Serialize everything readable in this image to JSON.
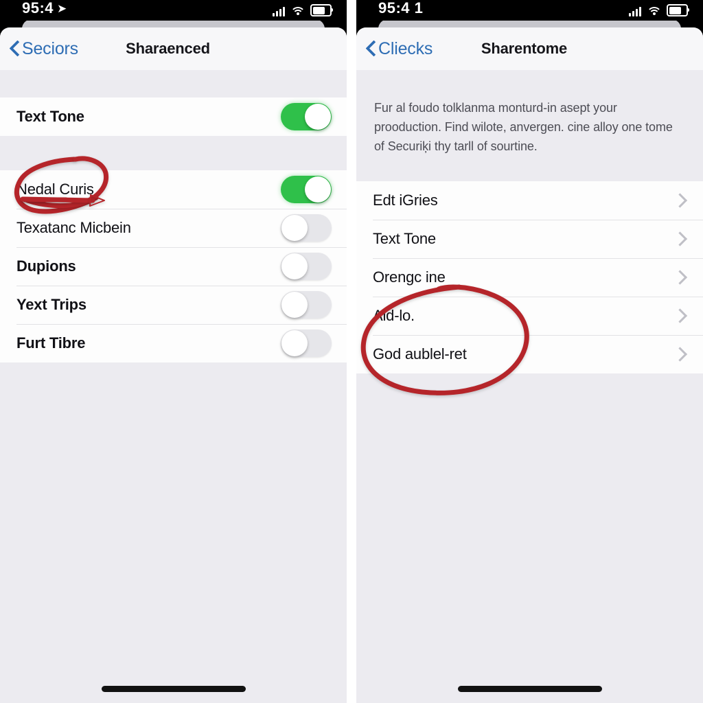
{
  "meta": {
    "accent_blue": "#2E6DB4",
    "toggle_green": "#2FC04A",
    "annotation_red": "#B5252A",
    "background_gray": "#ECEBF0",
    "row_white": "#FDFDFD"
  },
  "left": {
    "status": {
      "time": "95:4",
      "location_icon": "➤",
      "signal_icon": "signal-bars-icon",
      "wifi_icon": "wifi-icon",
      "battery_icon": "battery-icon"
    },
    "nav": {
      "back_label": "Seciors",
      "title": "Sharaenced"
    },
    "group_one": [
      {
        "label": "Text Tone",
        "bold": true,
        "toggle": "on"
      }
    ],
    "group_two": [
      {
        "label": "Nedal Curis",
        "bold": false,
        "toggle": "on",
        "annotated": true
      },
      {
        "label": "Texatanc Micbein",
        "bold": false,
        "toggle": "off"
      },
      {
        "label": "Dupions",
        "bold": true,
        "toggle": "off"
      },
      {
        "label": "Yext Trips",
        "bold": true,
        "toggle": "off"
      },
      {
        "label": "Furt Tibre",
        "bold": true,
        "toggle": "off"
      }
    ]
  },
  "right": {
    "status": {
      "time": "95:4 1",
      "signal_icon": "signal-bars-icon",
      "wifi_icon": "wifi-icon",
      "battery_icon": "battery-icon"
    },
    "nav": {
      "back_label": "Cliecks",
      "title": "Sharentome"
    },
    "description": "Fur al foudo tolklanma monturd-in asept your prooduction. Find wilote, anvergen. cine alloy one tome of Securiķi thy tarll of sourtine.",
    "rows": [
      {
        "label": "Edt iGries",
        "chevron": true
      },
      {
        "label": "Text Tone",
        "chevron": true
      },
      {
        "label": "Orengc ine",
        "chevron": true
      },
      {
        "label": "Ald-lo.",
        "chevron": true,
        "annotated": true
      },
      {
        "label": "God aublel-ret",
        "chevron": true,
        "annotated": true
      }
    ]
  }
}
